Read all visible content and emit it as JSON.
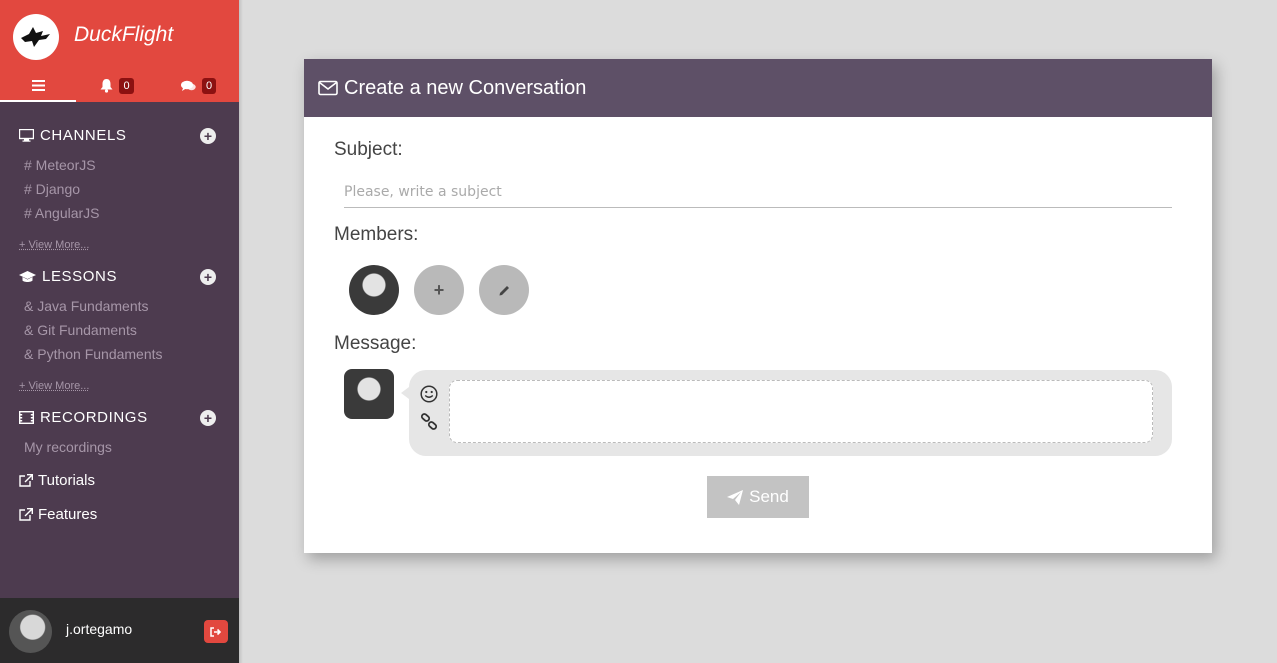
{
  "brand": {
    "name": "DuckFlight",
    "logo_icon": "duck-icon",
    "accent": "#e2483f"
  },
  "topbar": {
    "menu_icon": "menu-icon",
    "notifications": {
      "icon": "bell-icon",
      "count": "0"
    },
    "messages": {
      "icon": "chat-icon",
      "count": "0"
    }
  },
  "sidebar": {
    "channels": {
      "title": "CHANNELS",
      "items": [
        "# MeteorJS",
        "# Django",
        "# AngularJS"
      ],
      "view_more": "+ View More..."
    },
    "lessons": {
      "title": "LESSONS",
      "items": [
        "& Java Fundaments",
        "& Git Fundaments",
        "& Python Fundaments"
      ],
      "view_more": "+ View More..."
    },
    "recordings": {
      "title": "RECORDINGS",
      "items": [
        "My recordings"
      ]
    },
    "links": [
      "Tutorials",
      "Features"
    ],
    "user": {
      "name": "j.ortegamo"
    }
  },
  "conversation": {
    "header": "Create a new Conversation",
    "subject_label": "Subject:",
    "subject_placeholder": "Please, write a subject",
    "subject_value": "",
    "members_label": "Members:",
    "message_label": "Message:",
    "message_value": "",
    "send_label": "Send"
  }
}
